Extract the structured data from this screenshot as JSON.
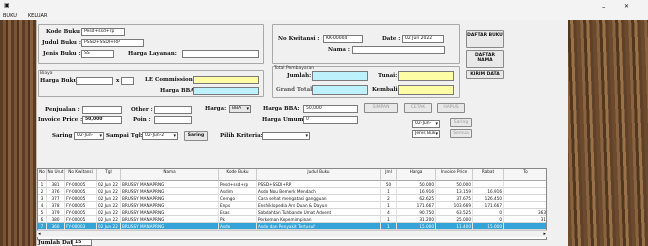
{
  "window": {
    "minimize": "–",
    "close": "✕"
  },
  "menu": {
    "file": "BUKU",
    "exit": "KELUAR"
  },
  "buku": {
    "kode_label": "Kode Buku :",
    "kode_value": "Pesd+ssd+rp",
    "judul_label": "Judul Buku :",
    "judul_value": "PSSD+SSDI+RP",
    "jenis_label": "Jenis Buku :",
    "jenis_value": "SS",
    "harga_layanan_label": "Harga Layanan:",
    "harga_layanan_value": ""
  },
  "kwitansi": {
    "no_label": "No Kwitansi :",
    "no_value": "KK-00004",
    "date_label": "Date :",
    "date_value": "02 Jun 2022",
    "nama_label": "Nama :",
    "nama_value": ""
  },
  "buttons": {
    "daftar_buku": "DAFTAR BUKU",
    "daftar_nama": "DAFTAR NAMA",
    "kirim_data": "KIRIM DATA",
    "simpan": "SIMPAN",
    "cetak": "CETAK",
    "hapus": "HAPUS",
    "saring_right": "Saring",
    "semua": "Semua",
    "saring": "Saring"
  },
  "harga": {
    "group_label": "Biaya",
    "harga_buku_label": "Harga Buku :",
    "harga_buku_value": "",
    "x": "x",
    "qty_value": "",
    "le_commission_label": "LE Commissione :",
    "le_commission_value": "",
    "harga_bba_label": "Harga BBA :",
    "harga_bba_value": ""
  },
  "pembayaran": {
    "group_label": "Total Pembayaran",
    "jumlah_label": "Jumlah:",
    "jumlah_value": "",
    "tunai_label": "Tunai:",
    "tunai_value": "",
    "grand_total_label": "Grand Total:",
    "grand_total_value": "",
    "kembali_label": "Kembali:",
    "kembali_value": ""
  },
  "misc": {
    "perjualan_label": "Penjualan :",
    "perjualan_value": "",
    "other_label": "Other :",
    "other_value": "",
    "invoice_price_label": "Invoice Price :",
    "invoice_price_value": "50,000",
    "poin_label": "Poin :",
    "poin_value": "",
    "harga_label": "Harga:",
    "harga_select": "BBA",
    "harga_bba_label": "Harga BBA:",
    "harga_bba_value": "50,000",
    "harga_umum_label": "Harga Umum:",
    "harga_umum_value": "0"
  },
  "filter": {
    "saring_tgl_label": "Saring Tgl :",
    "from_value": "02-Jun-",
    "sampai_label": "Sampai Tgl:",
    "to_value": "02-Jun-2",
    "kriteria_label": "Pilih Kriteria:",
    "kriteria_value": "",
    "right_date": "02-Jun-",
    "jenis_value": "Jenis Buk"
  },
  "table": {
    "headers": [
      "No",
      "No Urut",
      "No Kwitansi",
      "Tgl",
      "Nama",
      "Kode Buku",
      "Judul Buku",
      "Jml",
      "Harga",
      "Invoice Price",
      "Rabat",
      "To"
    ],
    "rows": [
      [
        "1",
        "381",
        "FY-00005",
        "02 Jun 22",
        "BRUSSY MANAPRNG",
        "Pesd+ssd+rp",
        "PSSD+SSDI+RP",
        "50",
        "50.000",
        "50.000",
        "",
        "",
        false
      ],
      [
        "2",
        "376",
        "FY-00005",
        "02 Jun 22",
        "BRUSSY MANAPRNG",
        "Asdim",
        "Asdo Nou Bemerk Mendach",
        "1",
        "16.916",
        "13.159",
        "16.916",
        "",
        false
      ],
      [
        "3",
        "377",
        "FY-00005",
        "02 Jun 22",
        "BRUSSY MANAPRNG",
        "Cerngo",
        "Cara sehat mengatasi gangguan",
        "2",
        "62.625",
        "37.675",
        "126.450",
        "",
        false
      ],
      [
        "4",
        "378",
        "FY-00005",
        "02 Jun 22",
        "BRUSSY MANAPRNG",
        "Enps",
        "Enshiklopedia Ars Duan & Dayun",
        "1",
        "171.667",
        "103.669",
        "171.667",
        "",
        false
      ],
      [
        "5",
        "379",
        "FY-00005",
        "02 Jun 22",
        "BRUSSY MANAPRNG",
        "Esas",
        "Sabdahtan Tuhbande Umat Advent",
        "4",
        "90.750",
        "63.525",
        "0",
        "363",
        false
      ],
      [
        "6",
        "380",
        "FY-00005",
        "02 Jun 22",
        "BRUSSY MANAPRNG",
        "Pk",
        "Perkeman Kepemimpinan",
        "1",
        "31.200",
        "25.000",
        "0",
        "31",
        false
      ],
      [
        "7",
        "360",
        "FY-00003",
        "02 Jun 22",
        "BRUSSY MANAPRNG",
        "Asdo",
        "Asdo dan Penyakit Tertusuf",
        "1",
        "15.000",
        "11.400",
        "15.000",
        "",
        true
      ]
    ]
  },
  "footer": {
    "jumlah_data_label": "Jumlah Data:",
    "jumlah_data_value": "15"
  }
}
